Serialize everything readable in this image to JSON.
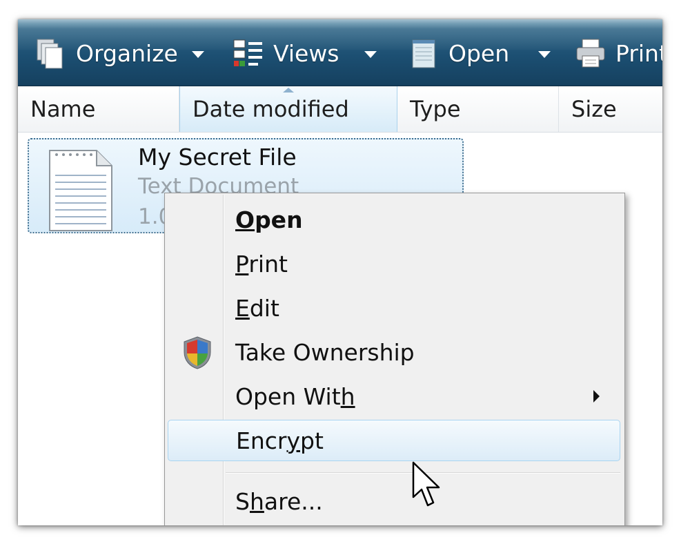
{
  "toolbar": {
    "organize": {
      "label": "Organize",
      "icon": "organize-icon"
    },
    "views": {
      "label": "Views",
      "icon": "views-icon"
    },
    "open": {
      "label": "Open",
      "icon": "notepad-icon"
    },
    "print": {
      "label": "Print",
      "icon": "printer-icon"
    }
  },
  "columns": [
    "Name",
    "Date modified",
    "Type",
    "Size"
  ],
  "sorted_column": "Date modified",
  "file": {
    "name": "My Secret File",
    "type": "Text Document",
    "size": "1.0"
  },
  "context_menu": {
    "items": [
      {
        "pre": "",
        "ul": "O",
        "post": "pen",
        "bold": true
      },
      {
        "pre": "",
        "ul": "P",
        "post": "rint"
      },
      {
        "pre": "",
        "ul": "E",
        "post": "dit"
      },
      {
        "label": "Take Ownership",
        "icon": "uac-shield-icon"
      },
      {
        "pre": "Open Wit",
        "ul": "h",
        "post": "",
        "submenu": true
      },
      {
        "pre": "Encr",
        "ul": "y",
        "post": "pt",
        "highlighted": true
      },
      {
        "pre": "S",
        "ul": "h",
        "post": "are..."
      }
    ]
  },
  "colors": {
    "toolbar_dark": "#15405f",
    "toolbar_light": "#5b8ca7",
    "selection_border": "#a8d4f1",
    "selection_fill": "#dcecf8"
  }
}
